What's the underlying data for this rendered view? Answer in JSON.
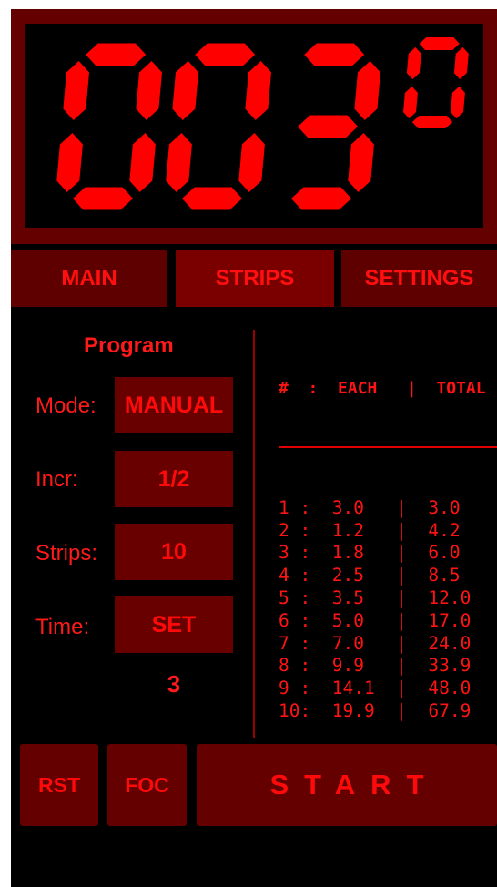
{
  "display": {
    "digits": "003",
    "superscript": "0"
  },
  "tabs": [
    {
      "label": "MAIN",
      "active": false
    },
    {
      "label": "STRIPS",
      "active": true
    },
    {
      "label": "SETTINGS",
      "active": false
    }
  ],
  "program": {
    "title": "Program",
    "mode_label": "Mode:",
    "mode_value": "MANUAL",
    "incr_label": "Incr:",
    "incr_value": "1/2",
    "strips_label": "Strips:",
    "strips_value": "10",
    "time_label": "Time:",
    "time_value": "SET",
    "timer_value": "3"
  },
  "table": {
    "header": "#  :  EACH   |  TOTAL",
    "rows": [
      {
        "n": "1 ",
        "each": "3.0 ",
        "total": "3.0"
      },
      {
        "n": "2 ",
        "each": "1.2 ",
        "total": "4.2"
      },
      {
        "n": "3 ",
        "each": "1.8 ",
        "total": "6.0"
      },
      {
        "n": "4 ",
        "each": "2.5 ",
        "total": "8.5"
      },
      {
        "n": "5 ",
        "each": "3.5 ",
        "total": "12.0"
      },
      {
        "n": "6 ",
        "each": "5.0 ",
        "total": "17.0"
      },
      {
        "n": "7 ",
        "each": "7.0 ",
        "total": "24.0"
      },
      {
        "n": "8 ",
        "each": "9.9 ",
        "total": "33.9"
      },
      {
        "n": "9 ",
        "each": "14.1",
        "total": "48.0"
      },
      {
        "n": "10",
        "each": "19.9",
        "total": "67.9"
      }
    ]
  },
  "buttons": {
    "rst": "RST",
    "foc": "FOC",
    "start": "START"
  },
  "colors": {
    "led": "#ff0000",
    "frame": "#650000",
    "button": "#640000",
    "text": "#ff1a1a"
  }
}
